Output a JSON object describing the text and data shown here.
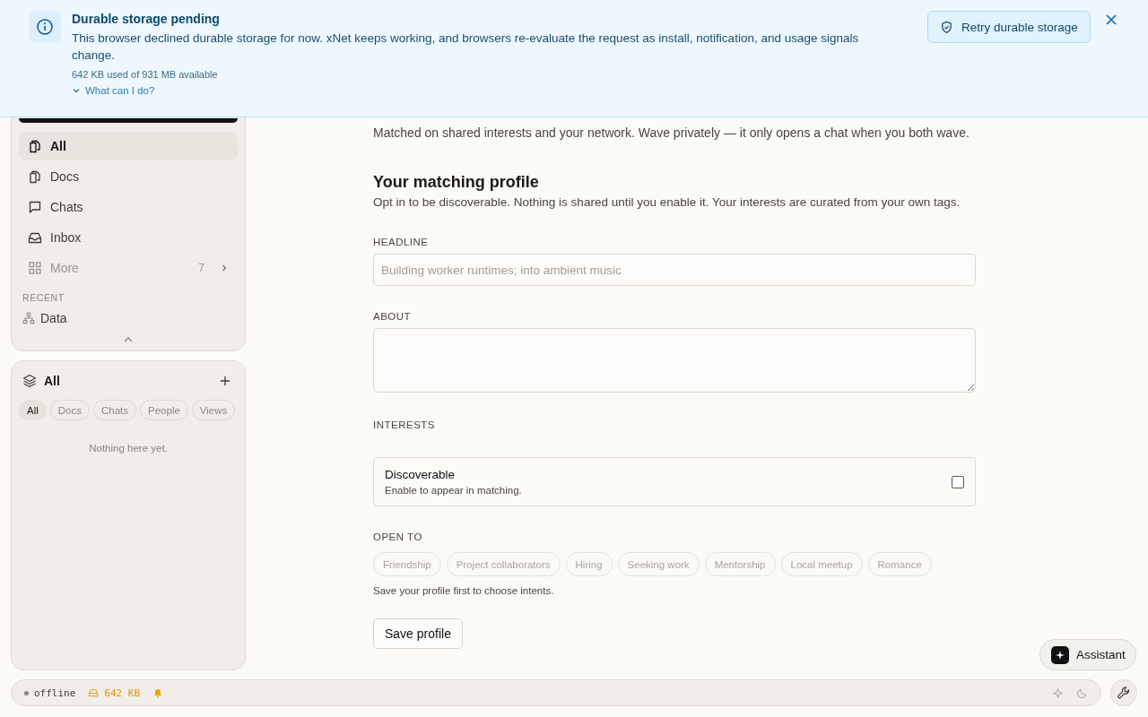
{
  "banner": {
    "title": "Durable storage pending",
    "message": "This browser declined durable storage for now. xNet keeps working, and browsers re-evaluate the request as install, notification, and usage signals change.",
    "usage": "642 KB used of 931 MB available",
    "help_link": "What can I do?",
    "retry_button": "Retry durable storage"
  },
  "sidebar": {
    "nav": [
      {
        "label": "All",
        "kind": "link",
        "selected": true
      },
      {
        "label": "Docs",
        "kind": "link",
        "selected": false
      },
      {
        "label": "Chats",
        "kind": "link",
        "selected": false
      },
      {
        "label": "Inbox",
        "kind": "link",
        "selected": false
      },
      {
        "label": "More",
        "kind": "more",
        "selected": false,
        "count": "7"
      }
    ],
    "recent": {
      "heading": "RECENT",
      "items": [
        {
          "label": "Data"
        }
      ]
    }
  },
  "collections": {
    "title": "All",
    "filters": [
      {
        "label": "All",
        "selected": true
      },
      {
        "label": "Docs",
        "selected": false
      },
      {
        "label": "Chats",
        "selected": false
      },
      {
        "label": "People",
        "selected": false
      },
      {
        "label": "Views",
        "selected": false
      }
    ],
    "empty": "Nothing here yet."
  },
  "main": {
    "subtitle": "Matched on shared interests and your network. Wave privately — it only opens a chat when you both wave.",
    "profile": {
      "heading": "Your matching profile",
      "description": "Opt in to be discoverable. Nothing is shared until you enable it. Your interests are curated from your own tags.",
      "headline": {
        "label": "HEADLINE",
        "placeholder": "Building worker runtimes; into ambient music"
      },
      "about": {
        "label": "ABOUT"
      },
      "interests": {
        "label": "INTERESTS"
      },
      "discoverable": {
        "title": "Discoverable",
        "description": "Enable to appear in matching.",
        "checked": false
      },
      "open_to": {
        "label": "OPEN TO",
        "chips": [
          {
            "label": "Friendship",
            "disabled": true
          },
          {
            "label": "Project collaborators",
            "disabled": true
          },
          {
            "label": "Hiring",
            "disabled": true
          },
          {
            "label": "Seeking work",
            "disabled": true
          },
          {
            "label": "Mentorship",
            "disabled": true
          },
          {
            "label": "Local meetup",
            "disabled": true
          },
          {
            "label": "Romance",
            "disabled": true
          }
        ],
        "hint": "Save your profile first to choose intents."
      },
      "save_button": "Save profile"
    }
  },
  "status_bar": {
    "connection": "offline",
    "storage": "642 KB"
  },
  "assistant_button": "Assistant"
}
